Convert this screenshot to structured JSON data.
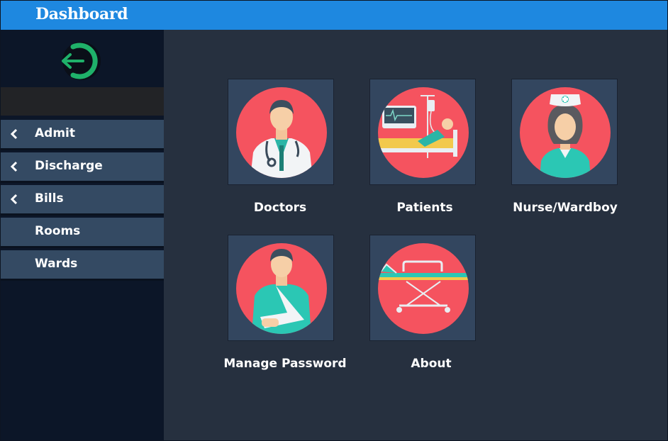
{
  "window": {
    "title": "Dashboard"
  },
  "sidebar": {
    "logout_icon": "logout-icon",
    "items": [
      {
        "label": "Admit",
        "has_chevron": true
      },
      {
        "label": "Discharge",
        "has_chevron": true
      },
      {
        "label": "Bills",
        "has_chevron": true
      },
      {
        "label": "Rooms",
        "has_chevron": false
      },
      {
        "label": "Wards",
        "has_chevron": false
      }
    ]
  },
  "tiles": [
    {
      "label": "Doctors",
      "icon": "doctor-icon"
    },
    {
      "label": "Patients",
      "icon": "patient-bed-icon"
    },
    {
      "label": "Nurse/Wardboy",
      "icon": "nurse-icon"
    },
    {
      "label": "Manage Password",
      "icon": "injured-person-icon"
    },
    {
      "label": "About",
      "icon": "stretcher-icon"
    }
  ],
  "colors": {
    "titlebar": "#1e88e0",
    "sidebar": "#0c1628",
    "menu_item": "#344a63",
    "main": "#26303f",
    "tile": "#33465f",
    "icon_circle": "#f5535f",
    "logout_green": "#1fb16a"
  }
}
